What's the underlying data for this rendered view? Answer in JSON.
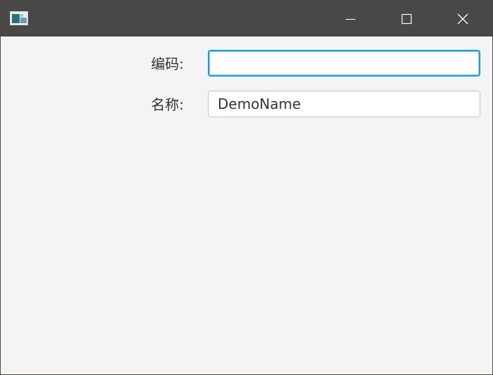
{
  "window": {
    "app_icon": "app-window-icon",
    "controls": {
      "minimize_icon": "minimize-icon",
      "maximize_icon": "maximize-icon",
      "close_icon": "close-icon"
    },
    "titlebar_color": "#4a4846"
  },
  "form": {
    "code": {
      "label": "编码:",
      "value": "",
      "focused": true,
      "focus_color": "#1a9ad6"
    },
    "name": {
      "label": "名称:",
      "value": "DemoName"
    }
  }
}
